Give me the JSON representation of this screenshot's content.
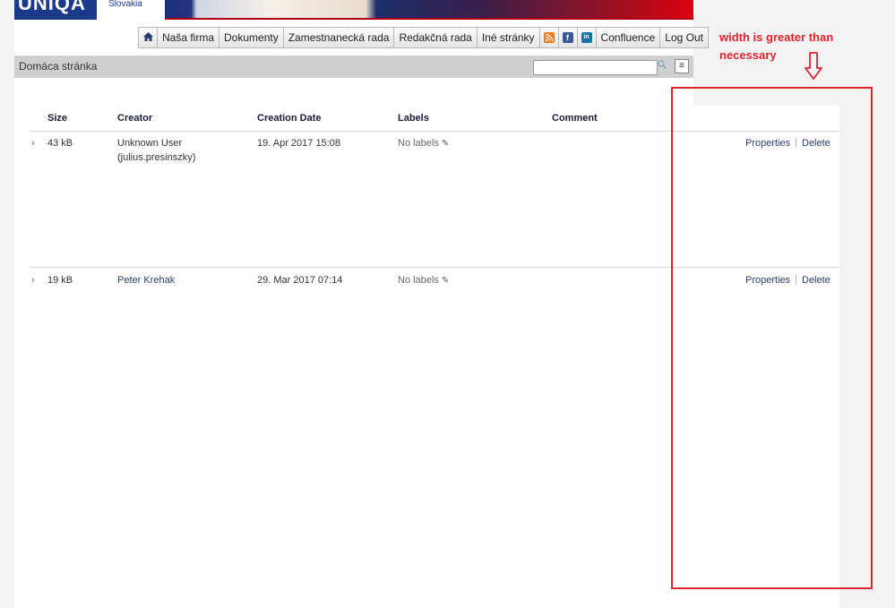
{
  "banner": {
    "logo": "UNIQA",
    "logo_sub": "Slovakia"
  },
  "nav": {
    "home_icon": "home-icon",
    "items": [
      "Naša firma",
      "Dokumenty",
      "Zamestnanecká rada",
      "Redakčná rada",
      "Iné stránky"
    ],
    "social_icons": [
      "rss-icon",
      "facebook-icon",
      "linkedin-icon"
    ],
    "after": [
      "Confluence",
      "Log Out"
    ]
  },
  "titlebar": {
    "title": "Domáca stránka",
    "search_placeholder": ""
  },
  "table": {
    "headers": {
      "size": "Size",
      "creator": "Creator",
      "date": "Creation Date",
      "labels": "Labels",
      "comment": "Comment"
    },
    "rows": [
      {
        "size": "43 kB",
        "creator_line1": "Unknown User",
        "creator_line2": "(julius.presinszky)",
        "date": "19. Apr 2017 15:08",
        "labels": "No labels",
        "properties": "Properties",
        "delete": "Delete"
      },
      {
        "size": "19 kB",
        "creator_line1": "Peter Krehak",
        "creator_line2": "",
        "date": "29. Mar 2017 07:14",
        "labels": "No labels",
        "properties": "Properties",
        "delete": "Delete"
      }
    ]
  },
  "annotation": {
    "line1": "width is greater than",
    "line2": "necessary"
  },
  "colors": {
    "annotation": "#e0242e",
    "brand": "#1b3a8c",
    "link": "#2a3b6e"
  }
}
